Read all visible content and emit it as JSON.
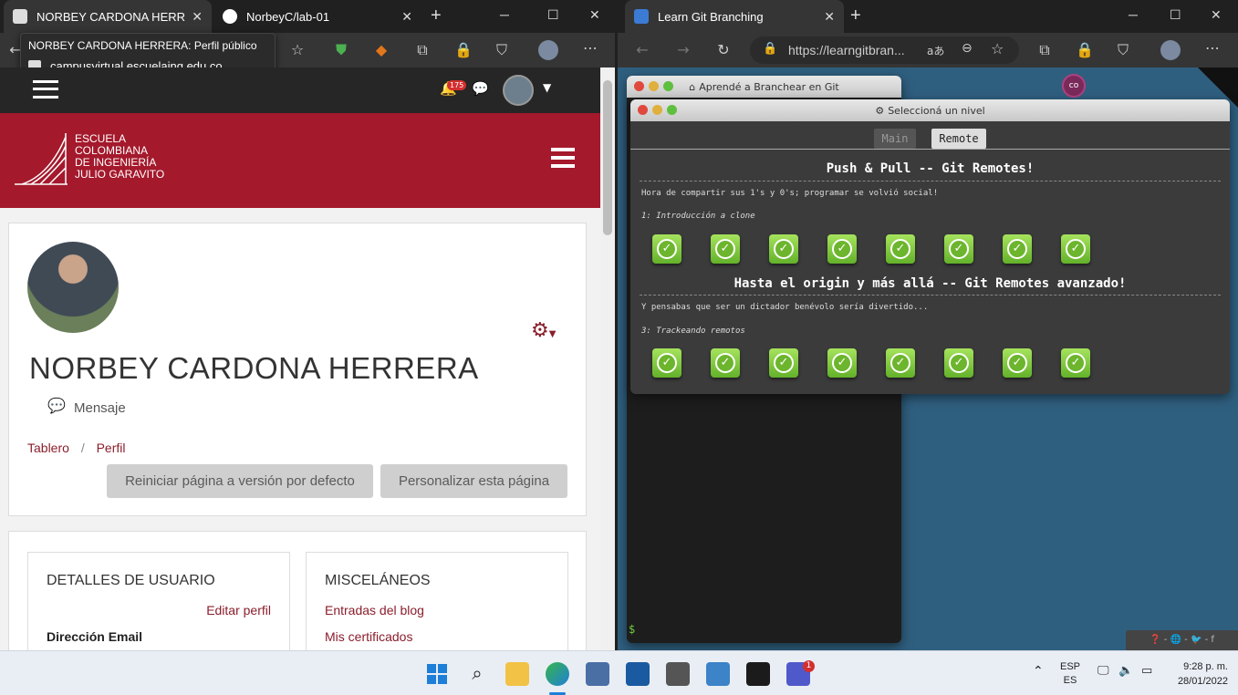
{
  "left_browser": {
    "tabs": [
      {
        "label": "NORBEY CARDONA HERRERA: Perfil público",
        "close": "✕"
      },
      {
        "label": "NorbeyC/lab-01",
        "close": "✕"
      }
    ],
    "new_tab": "+",
    "tooltip": {
      "title": "NORBEY CARDONA HERRERA: Perfil público",
      "url": "campusvirtual.escuelaing.edu.co"
    }
  },
  "moodle": {
    "notif_count": "175",
    "logo_lines": [
      "Escuela",
      "Colombiana",
      "de Ingeniería",
      "Julio Garavito"
    ],
    "profile_name": "NORBEY CARDONA HERRERA",
    "message_label": "Mensaje",
    "breadcrumb": [
      "Tablero",
      "/",
      "Perfil"
    ],
    "reset_button": "Reiniciar página a versión por defecto",
    "customize_button": "Personalizar esta página",
    "user_details": {
      "heading": "DETALLES DE USUARIO",
      "edit_link": "Editar perfil",
      "email_label": "Dirección Email"
    },
    "misc": {
      "heading": "MISCELÁNEOS",
      "links": [
        "Entradas del blog",
        "Mis certificados"
      ]
    }
  },
  "right_browser": {
    "tab_label": "Learn Git Branching",
    "url": "https://learngitbran...",
    "translate_icon": "aあ"
  },
  "git": {
    "back_window_title": "Aprendé a Branchear en Git",
    "level_window_title": "Seleccioná un nivel",
    "tabs": [
      "Main",
      "Remote"
    ],
    "sections": [
      {
        "title": "Push & Pull -- Git Remotes!",
        "desc": "Hora de compartir sus 1's y 0's; programar se volvió social!",
        "sub": "1: Introducción a clone",
        "levels": 8
      },
      {
        "title": "Hasta el origin y más allá -- Git Remotes avanzado!",
        "desc": "Y pensabas que ser un dictador benévolo sería divertido...",
        "sub": "3: Trackeando remotos",
        "levels": 8
      }
    ],
    "avatar_badge": "co",
    "prompt": "$",
    "footer_icons": "❓ - 🌐 - 🐦 - f"
  },
  "taskbar": {
    "lang_top": "ESP",
    "lang_bottom": "ES",
    "time": "9:28 p. m.",
    "date": "28/01/2022",
    "teams_badge": "1"
  },
  "colors": {
    "moodle_red": "#a4192c",
    "git_blue": "#2f5f7f",
    "level_green": "#7ccb3b"
  }
}
